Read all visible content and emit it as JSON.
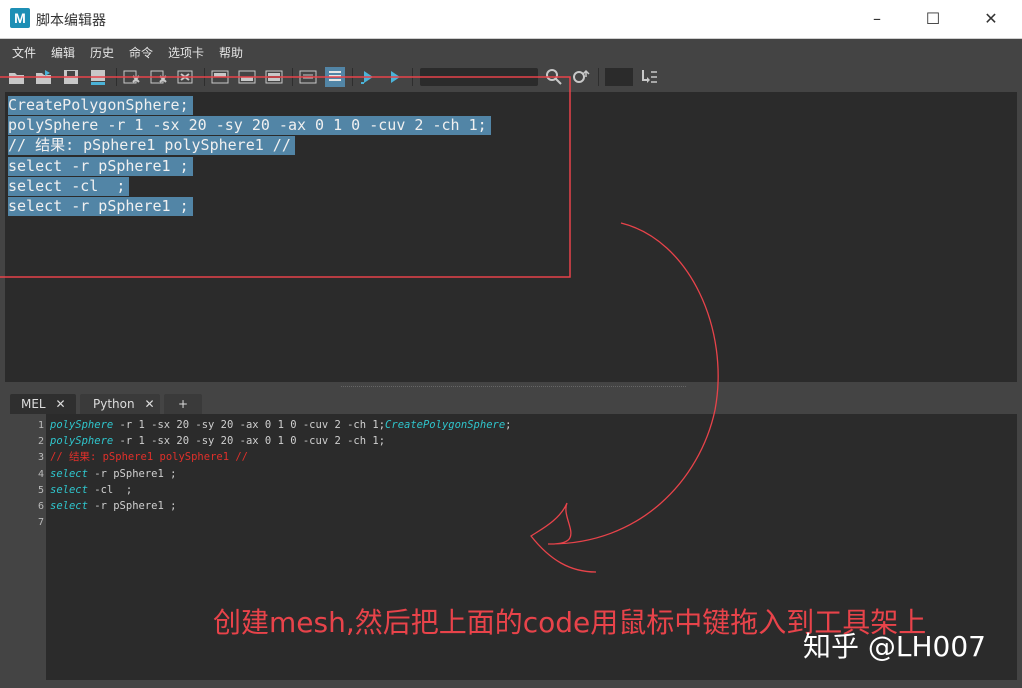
{
  "window": {
    "title": "脚本编辑器",
    "controls": [
      "–",
      "☐",
      "✕"
    ]
  },
  "menu": [
    "文件",
    "编辑",
    "历史",
    "命令",
    "选项卡",
    "帮助"
  ],
  "toolbar": {
    "icons": [
      "open-script-icon",
      "source-script-icon",
      "save-script-icon",
      "save-to-shelf-icon",
      "clear-history-icon",
      "clear-input-icon",
      "clear-all-icon",
      "show-history-icon",
      "show-input-icon",
      "show-both-icon",
      "echo-all-icon",
      "line-numbers-icon",
      "execute-all-icon",
      "execute-icon",
      "search-icon",
      "goto-line-icon",
      "indent-icon"
    ],
    "search_value": ""
  },
  "history": {
    "lines": [
      "CreatePolygonSphere;",
      "polySphere -r 1 -sx 20 -sy 20 -ax 0 1 0 -cuv 2 -ch 1;",
      "// 结果: pSphere1 polySphere1 //",
      "select -r pSphere1 ;",
      "select -cl  ;",
      "select -r pSphere1 ;"
    ]
  },
  "tabs": [
    {
      "label": "MEL",
      "close": "✕"
    },
    {
      "label": "Python",
      "close": "✕"
    },
    {
      "label": "+"
    }
  ],
  "editor": {
    "line_numbers": [
      "1",
      "2",
      "3",
      "4",
      "5",
      "6",
      "7"
    ],
    "lines": [
      {
        "kw": "polySphere",
        "rest": " -r 1 -sx 20 -sy 20 -ax 0 1 0 -cuv 2 -ch 1;",
        "kw2": "CreatePolygonSphere",
        "rest2": ";"
      },
      {
        "kw": "polySphere",
        "rest": " -r 1 -sx 20 -sy 20 -ax 0 1 0 -cuv 2 -ch 1;"
      },
      {
        "comment": "// 结果: pSphere1 polySphere1 //"
      },
      {
        "kw": "select",
        "rest": " -r pSphere1 ;"
      },
      {
        "kw": "select",
        "rest": " -cl  ;"
      },
      {
        "kw": "select",
        "rest": " -r pSphere1 ;"
      }
    ]
  },
  "annotation": {
    "text": "创建mesh,然后把上面的code用鼠标中键拖入到工具架上",
    "color": "#e8434a"
  },
  "watermark": "知乎 @LH007"
}
